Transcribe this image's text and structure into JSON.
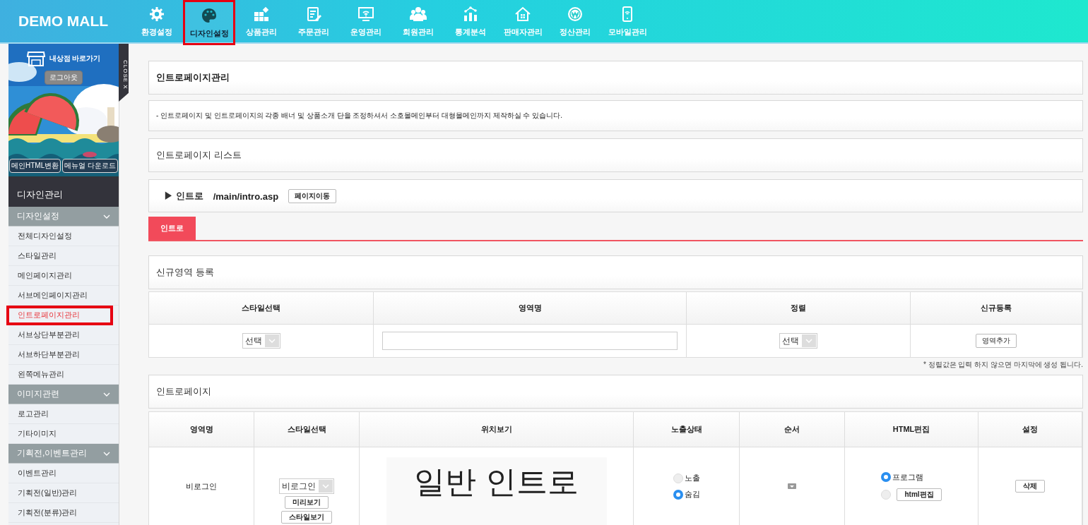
{
  "brand": "DEMO MALL",
  "nav": [
    {
      "label": "환경설정",
      "selected": false
    },
    {
      "label": "디자인설정",
      "selected": true
    },
    {
      "label": "상품관리",
      "selected": false
    },
    {
      "label": "주문관리",
      "selected": false
    },
    {
      "label": "운영관리",
      "selected": false
    },
    {
      "label": "회원관리",
      "selected": false
    },
    {
      "label": "통계분석",
      "selected": false
    },
    {
      "label": "판매자관리",
      "selected": false
    },
    {
      "label": "정산관리",
      "selected": false
    },
    {
      "label": "모바일관리",
      "selected": false
    }
  ],
  "sidebar": {
    "store_link": "내상점 바로가기",
    "logout": "로그아웃",
    "buttons": [
      "메인HTML변환",
      "메뉴얼 다운로드"
    ],
    "close": "CLOSE X",
    "section": "디자인관리",
    "groups": [
      {
        "label": "디자인설정",
        "items": [
          {
            "label": "전체디자인설정",
            "selected": false
          },
          {
            "label": "스타일관리",
            "selected": false
          },
          {
            "label": "메인페이지관리",
            "selected": false
          },
          {
            "label": "서브메인페이지관리",
            "selected": false
          },
          {
            "label": "인트로페이지관리",
            "selected": true
          },
          {
            "label": "서브상단부분관리",
            "selected": false
          },
          {
            "label": "서브하단부분관리",
            "selected": false
          },
          {
            "label": "왼쪽메뉴관리",
            "selected": false
          }
        ]
      },
      {
        "label": "이미지관련",
        "items": [
          {
            "label": "로고관리",
            "selected": false
          },
          {
            "label": "기타이미지",
            "selected": false
          }
        ]
      },
      {
        "label": "기획전,이벤트관리",
        "items": [
          {
            "label": "이벤트관리",
            "selected": false
          },
          {
            "label": "기획전(일반)관리",
            "selected": false
          },
          {
            "label": "기획전(분류)관리",
            "selected": false
          }
        ]
      }
    ]
  },
  "page_title": "인트로페이지관리",
  "description": "- 인트로페이지 및 인트로페이지의 각종 배너 및 상품소개 단을 조정하셔서 소호몰메인부터 대형몰메인까지 제작하실 수 있습니다.",
  "list_title": "인트로페이지 리스트",
  "intro_link": {
    "marker": "▶",
    "label": "인트로",
    "path": "/main/intro.asp",
    "button": "페이지이동"
  },
  "tabs": [
    {
      "label": "인트로",
      "selected": true
    }
  ],
  "new_area": {
    "title": "신규영역 등록",
    "columns": [
      "스타일선택",
      "영역명",
      "정렬",
      "신규등록"
    ],
    "style_select": "선택",
    "sort_select": "선택",
    "add_button": "영역추가",
    "note": "* 정렬값은 입력 하지 않으면 마지막에 생성 됩니다."
  },
  "intro_section": "인트로페이지",
  "intro_table": {
    "columns": [
      "영역명",
      "스타일선택",
      "위치보기",
      "노출상태",
      "순서",
      "HTML편집",
      "설정"
    ],
    "rows": [
      {
        "area_name": "비로그인",
        "style_select": "비로그인",
        "buttons": [
          "미리보기",
          "스타일보기"
        ],
        "preview": "일반 인트로",
        "visibility": [
          {
            "label": "노출",
            "selected": false
          },
          {
            "label": "숨김",
            "selected": true
          }
        ],
        "html_edit": [
          {
            "label": "프로그램",
            "kind": "text",
            "selected": true
          },
          {
            "label": "html편집",
            "kind": "button",
            "selected": false
          }
        ],
        "action": "삭제"
      }
    ]
  }
}
